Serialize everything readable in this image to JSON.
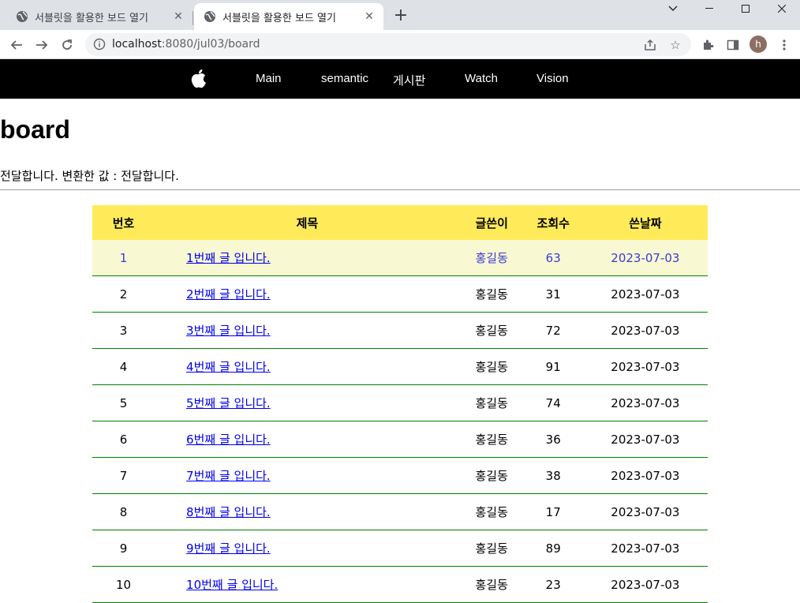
{
  "browser": {
    "tabs": [
      {
        "title": "서블릿을 활용한 보드 열기",
        "active": false
      },
      {
        "title": "서블릿을 활용한 보드 열기",
        "active": true
      }
    ],
    "url_host": "localhost",
    "url_rest": ":8080/jul03/board",
    "profile_initial": "h"
  },
  "nav": {
    "logo": "apple-logo",
    "items": [
      "Main",
      "semantic",
      "게시판",
      "Watch",
      "Vision"
    ]
  },
  "page": {
    "title": "board",
    "message": "전달합니다. 변환한 값 : 전달합니다."
  },
  "board": {
    "headers": [
      "번호",
      "제목",
      "글쓴이",
      "조회수",
      "쓴날짜"
    ],
    "rows": [
      {
        "no": "1",
        "title": "1번째 글 입니다.",
        "writer": "홍길동",
        "views": "63",
        "date": "2023-07-03"
      },
      {
        "no": "2",
        "title": "2번째 글 입니다.",
        "writer": "홍길동",
        "views": "31",
        "date": "2023-07-03"
      },
      {
        "no": "3",
        "title": "3번째 글 입니다.",
        "writer": "홍길동",
        "views": "72",
        "date": "2023-07-03"
      },
      {
        "no": "4",
        "title": "4번째 글 입니다.",
        "writer": "홍길동",
        "views": "91",
        "date": "2023-07-03"
      },
      {
        "no": "5",
        "title": "5번째 글 입니다.",
        "writer": "홍길동",
        "views": "74",
        "date": "2023-07-03"
      },
      {
        "no": "6",
        "title": "6번째 글 입니다.",
        "writer": "홍길동",
        "views": "36",
        "date": "2023-07-03"
      },
      {
        "no": "7",
        "title": "7번째 글 입니다.",
        "writer": "홍길동",
        "views": "38",
        "date": "2023-07-03"
      },
      {
        "no": "8",
        "title": "8번째 글 입니다.",
        "writer": "홍길동",
        "views": "17",
        "date": "2023-07-03"
      },
      {
        "no": "9",
        "title": "9번째 글 입니다.",
        "writer": "홍길동",
        "views": "89",
        "date": "2023-07-03"
      },
      {
        "no": "10",
        "title": "10번째 글 입니다.",
        "writer": "홍길동",
        "views": "23",
        "date": "2023-07-03"
      }
    ]
  },
  "colors": {
    "nav_bg": "#000000",
    "header_bg": "#ffeb5a",
    "hover_row_bg": "#f8f8d2",
    "row_border": "#008000"
  }
}
